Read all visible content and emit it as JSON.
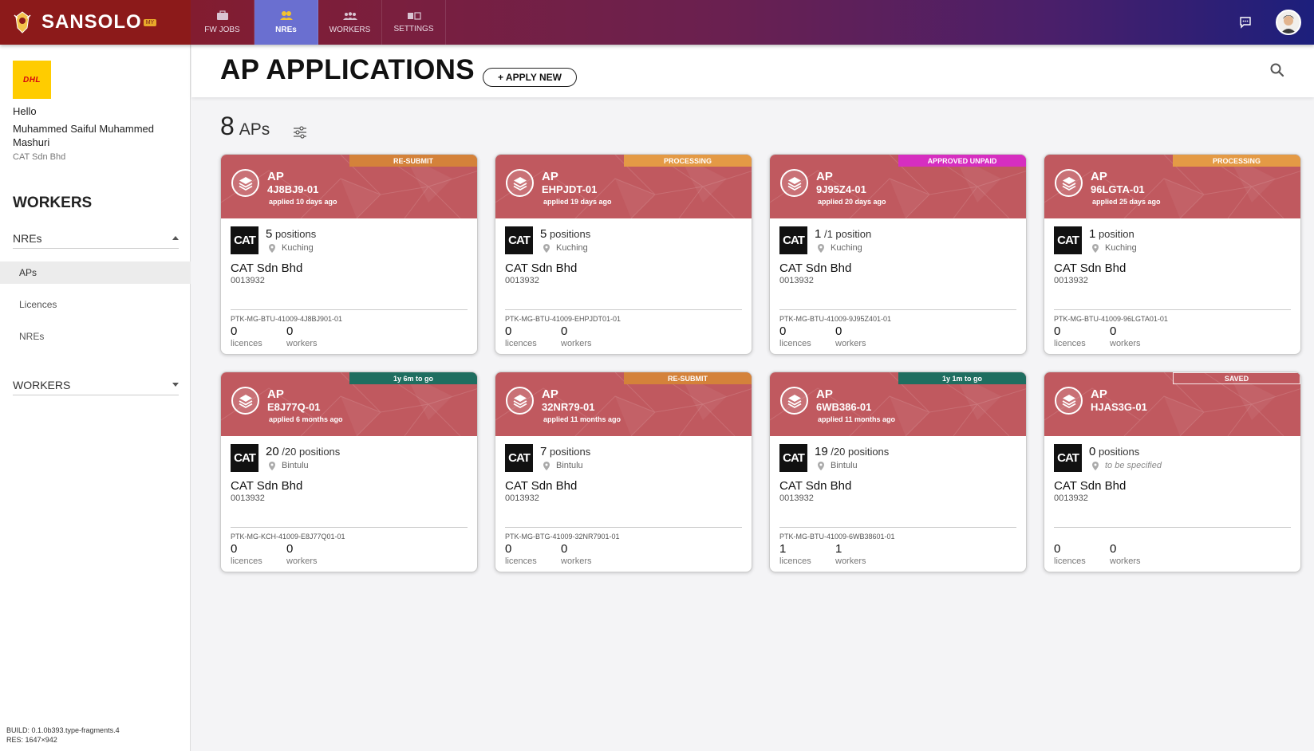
{
  "topbar": {
    "brand": "SANSOLO",
    "brand_badge": "MY",
    "nav": [
      {
        "label": "FW JOBS",
        "icon": "briefcase-icon",
        "active": false
      },
      {
        "label": "NREs",
        "icon": "people-icon",
        "active": true
      },
      {
        "label": "WORKERS",
        "icon": "group-icon",
        "active": false
      },
      {
        "label": "SETTINGS",
        "icon": "toggle-icon",
        "active": false
      }
    ]
  },
  "sidebar": {
    "company_logo_text": "DHL",
    "greeting": "Hello",
    "user_name": "Muhammed Saiful Muhammed Mashuri",
    "company": "CAT Sdn Bhd",
    "heading": "WORKERS",
    "group_nres": "NREs",
    "links": [
      "APs",
      "Licences",
      "NREs"
    ],
    "group_workers": "WORKERS",
    "build": "BUILD: 0.1.0b393.type-fragments.4",
    "res": "RES: 1647×942"
  },
  "header": {
    "title": "AP APPLICATIONS",
    "apply_button": "+ APPLY NEW"
  },
  "summary": {
    "count": "8",
    "label": "APs"
  },
  "colors": {
    "header_gradient_start": "#8a1a22",
    "header_gradient_end": "#1c1f7c",
    "card_head": "#c0595f",
    "nav_active": "#6a6fd0",
    "status_resubmit": "#d4823a",
    "status_processing": "#e49a45",
    "status_approved": "#d62ec0",
    "status_togo": "#1f6e60"
  },
  "cards": [
    {
      "status": "RE-SUBMIT",
      "status_type": "resubmit",
      "ap_label": "AP",
      "code": "4J8BJ9-01",
      "applied": "applied 10 days ago",
      "count": "5",
      "count_suffix": " positions",
      "location": "Kuching",
      "company": "CAT Sdn Bhd",
      "company_id": "0013932",
      "ref": "PTK-MG-BTU-41009-4J8BJ901-01",
      "licences": "0",
      "licences_label": "licences",
      "workers": "0",
      "workers_label": "workers"
    },
    {
      "status": "PROCESSING",
      "status_type": "processing",
      "ap_label": "AP",
      "code": "EHPJDT-01",
      "applied": "applied 19 days ago",
      "count": "5",
      "count_suffix": " positions",
      "location": "Kuching",
      "company": "CAT Sdn Bhd",
      "company_id": "0013932",
      "ref": "PTK-MG-BTU-41009-EHPJDT01-01",
      "licences": "0",
      "licences_label": "licences",
      "workers": "0",
      "workers_label": "workers"
    },
    {
      "status": "APPROVED UNPAID",
      "status_type": "approved",
      "ap_label": "AP",
      "code": "9J95Z4-01",
      "applied": "applied 20 days ago",
      "count": "1",
      "count_suffix": " /1 position",
      "location": "Kuching",
      "company": "CAT Sdn Bhd",
      "company_id": "0013932",
      "ref": "PTK-MG-BTU-41009-9J95Z401-01",
      "licences": "0",
      "licences_label": "licences",
      "workers": "0",
      "workers_label": "workers"
    },
    {
      "status": "PROCESSING",
      "status_type": "processing",
      "ap_label": "AP",
      "code": "96LGTA-01",
      "applied": "applied 25 days ago",
      "count": "1",
      "count_suffix": " position",
      "location": "Kuching",
      "company": "CAT Sdn Bhd",
      "company_id": "0013932",
      "ref": "PTK-MG-BTU-41009-96LGTA01-01",
      "licences": "0",
      "licences_label": "licences",
      "workers": "0",
      "workers_label": "workers"
    },
    {
      "status": "1y 6m to go",
      "status_type": "togo",
      "ap_label": "AP",
      "code": "E8J77Q-01",
      "applied": "applied 6 months ago",
      "count": "20",
      "count_suffix": " /20 positions",
      "location": "Bintulu",
      "company": "CAT Sdn Bhd",
      "company_id": "0013932",
      "ref": "PTK-MG-KCH-41009-E8J77Q01-01",
      "licences": "0",
      "licences_label": "licences",
      "workers": "0",
      "workers_label": "workers"
    },
    {
      "status": "RE-SUBMIT",
      "status_type": "resubmit",
      "ap_label": "AP",
      "code": "32NR79-01",
      "applied": "applied 11 months ago",
      "count": "7",
      "count_suffix": " positions",
      "location": "Bintulu",
      "company": "CAT Sdn Bhd",
      "company_id": "0013932",
      "ref": "PTK-MG-BTG-41009-32NR7901-01",
      "licences": "0",
      "licences_label": "licences",
      "workers": "0",
      "workers_label": "workers"
    },
    {
      "status": "1y 1m to go",
      "status_type": "togo",
      "ap_label": "AP",
      "code": "6WB386-01",
      "applied": "applied 11 months ago",
      "count": "19",
      "count_suffix": " /20 positions",
      "location": "Bintulu",
      "company": "CAT Sdn Bhd",
      "company_id": "0013932",
      "ref": "PTK-MG-BTU-41009-6WB38601-01",
      "licences": "1",
      "licences_label": "licences",
      "workers": "1",
      "workers_label": "workers"
    },
    {
      "status": "SAVED",
      "status_type": "saved",
      "ap_label": "AP",
      "code": "HJAS3G-01",
      "applied": "",
      "count": "0",
      "count_suffix": " positions",
      "location": "to be specified",
      "company": "CAT Sdn Bhd",
      "company_id": "0013932",
      "ref": "",
      "licences": "0",
      "licences_label": "licences",
      "workers": "0",
      "workers_label": "workers"
    }
  ]
}
